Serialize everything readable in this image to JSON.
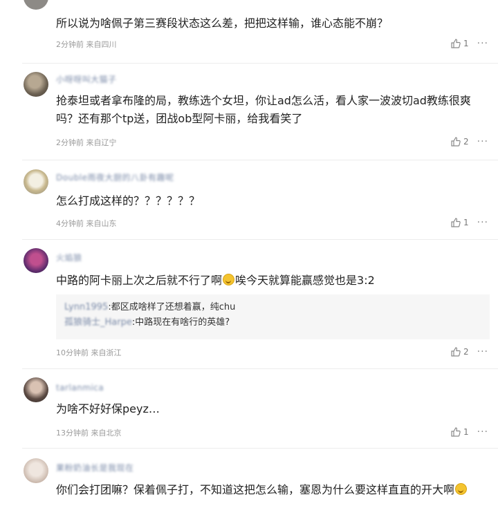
{
  "comments": [
    {
      "username": "",
      "text": "所以说为啥佩子第三赛段状态这么差，把把这样输，谁心态能不崩？",
      "meta": "2分钟前 来自四川",
      "likes": "1"
    },
    {
      "username": "小呀呀叫大猫子",
      "text": "抢泰坦或者拿布隆的局，教练选个女坦，你让ad怎么活，看人家一波波切ad教练很爽吗？还有那个tp送，团战ob型阿卡丽，给我看笑了",
      "meta": "2分钟前 来自辽宁",
      "likes": "2"
    },
    {
      "username": "Double雨夜大厨的八卦有趣呢",
      "text": "怎么打成这样的？？？？？？",
      "meta": "4分钟前 来自山东",
      "likes": "1"
    },
    {
      "username": "火焰狼",
      "text_before": "中路的阿卡丽上次之后就不行了啊",
      "text_after": "唉今天就算能赢感觉也是3:2",
      "replies": [
        {
          "name": "Lynn1995",
          "text": ":都区成啥样了还想着赢，纯chu"
        },
        {
          "name": "孤狼骑士_Harpe",
          "text": ":中路现在有啥行的英雄?"
        }
      ],
      "meta": "10分钟前 来自浙江",
      "likes": "2"
    },
    {
      "username": "tarlanmica",
      "text": "为啥不好好保peyz…",
      "meta": "13分钟前 来自北京",
      "likes": "1"
    },
    {
      "username": "果粉奶油长是我现在",
      "text_before": "你们会打团嘛？保着佩子打，不知道这把怎么输，塞恩为什么要这样直直的开大啊",
      "text_after": ""
    }
  ],
  "icons": {
    "like": "thumbs-up-icon",
    "more": "more-icon"
  },
  "colors": {
    "meta": "#9a9a9a",
    "username": "#7a8aa8",
    "reply_bg": "#f6f6f6"
  }
}
